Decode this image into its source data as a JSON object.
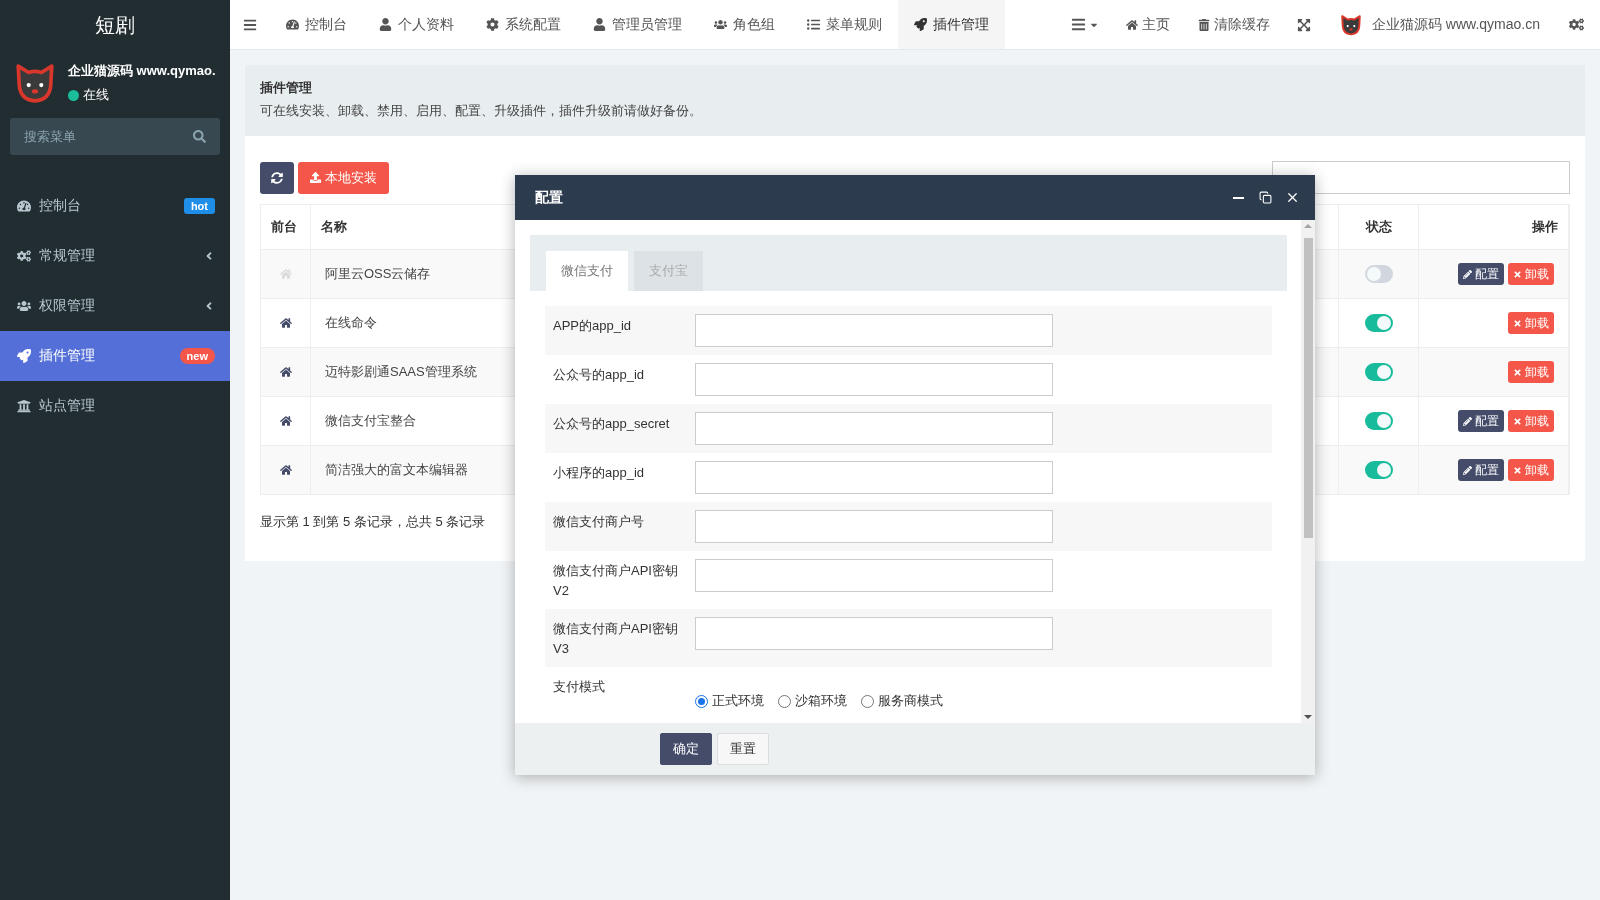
{
  "sidebar": {
    "title": "短剧",
    "user": {
      "name": "企业猫源码 www.qymao.",
      "status": "在线"
    },
    "search": {
      "placeholder": "搜索菜单"
    },
    "items": [
      {
        "label": "控制台",
        "kind": "link",
        "selected": false,
        "badge": {
          "text": "hot",
          "color": "#1f8ee8"
        }
      },
      {
        "label": "常规管理",
        "kind": "group",
        "selected": false,
        "expanded": false
      },
      {
        "label": "权限管理",
        "kind": "group",
        "selected": false,
        "expanded": false
      },
      {
        "label": "插件管理",
        "kind": "link",
        "selected": true,
        "badge": {
          "text": "new",
          "color": "#f4574a"
        }
      },
      {
        "label": "站点管理",
        "kind": "link",
        "selected": false
      }
    ]
  },
  "topbar": {
    "tabs": [
      {
        "label": "控制台",
        "selected": false
      },
      {
        "label": "个人资料",
        "selected": false
      },
      {
        "label": "系统配置",
        "selected": false
      },
      {
        "label": "管理员管理",
        "selected": false
      },
      {
        "label": "角色组",
        "selected": false
      },
      {
        "label": "菜单规则",
        "selected": false
      },
      {
        "label": "插件管理",
        "selected": true
      }
    ],
    "links": [
      {
        "label": "主页"
      },
      {
        "label": "清除缓存"
      }
    ],
    "site": "企业猫源码 www.qymao.cn"
  },
  "page": {
    "title": "插件管理",
    "description": "可在线安装、卸载、禁用、启用、配置、升级插件，插件升级前请做好备份。",
    "toolbar": {
      "install": "本地安装"
    },
    "table": {
      "columns": [
        "前台",
        "名称",
        "状态",
        "操作"
      ],
      "rows": [
        {
          "frontend": false,
          "name": "阿里云OSS云储存",
          "on": false,
          "actions": [
            "配置",
            "卸载"
          ]
        },
        {
          "frontend": true,
          "name": "在线命令",
          "on": true,
          "actions": [
            "卸载"
          ]
        },
        {
          "frontend": true,
          "name": "迈特影剧通SAAS管理系统",
          "on": true,
          "actions": [
            "卸载"
          ]
        },
        {
          "frontend": true,
          "name": "微信支付宝整合",
          "on": true,
          "actions": [
            "配置",
            "卸载"
          ]
        },
        {
          "frontend": true,
          "name": "简洁强大的富文本编辑器",
          "on": true,
          "actions": [
            "配置",
            "卸载"
          ]
        }
      ]
    },
    "pagination": "显示第 1 到第 5 条记录，总共 5 条记录"
  },
  "modal": {
    "title": "配置",
    "tabs": [
      {
        "label": "微信支付",
        "selected": true
      },
      {
        "label": "支付宝",
        "selected": false
      }
    ],
    "fields": [
      {
        "label": "APP的app_id",
        "kind": "text"
      },
      {
        "label": "公众号的app_id",
        "kind": "text"
      },
      {
        "label": "公众号的app_secret",
        "kind": "text"
      },
      {
        "label": "小程序的app_id",
        "kind": "text"
      },
      {
        "label": "微信支付商户号",
        "kind": "text"
      },
      {
        "label": "微信支付商户API密钥V2",
        "kind": "text"
      },
      {
        "label": "微信支付商户API密钥V3",
        "kind": "text"
      },
      {
        "label": "支付模式",
        "kind": "radio",
        "options": [
          {
            "label": "正式环境",
            "selected": true
          },
          {
            "label": "沙箱环境",
            "selected": false
          },
          {
            "label": "服务商模式",
            "selected": false
          }
        ]
      }
    ],
    "buttons": [
      "确定",
      "重置"
    ]
  }
}
